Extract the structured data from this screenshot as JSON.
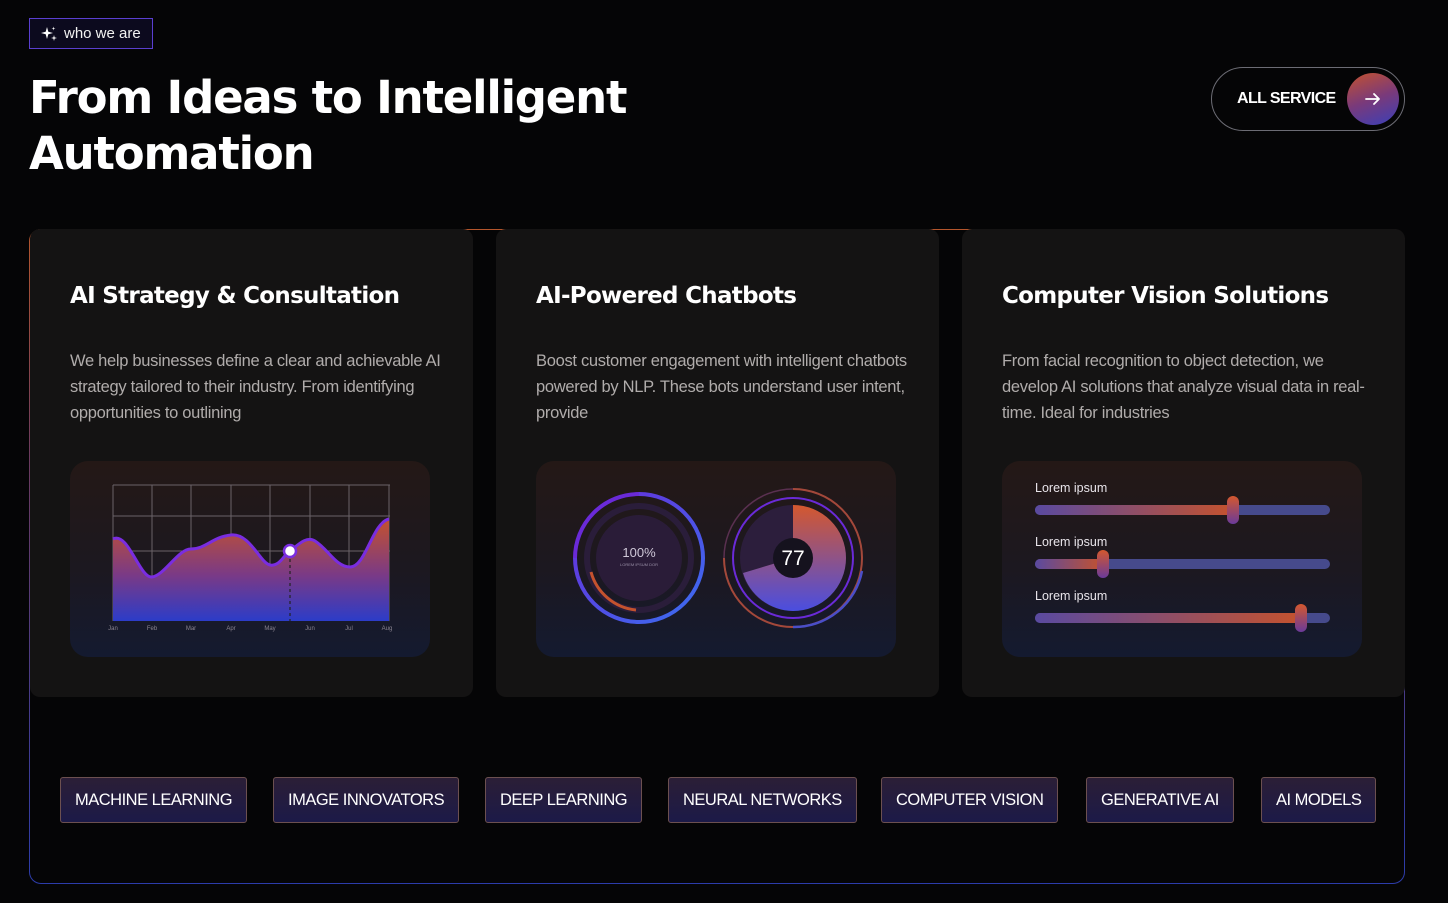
{
  "badge": {
    "label": "who we are",
    "icon": "sparkle-icon"
  },
  "hero": {
    "title": "From Ideas to Intelligent Automation"
  },
  "cta": {
    "label": "ALL SERVICE",
    "icon": "arrow-right-icon"
  },
  "colors": {
    "accent_orange": "#c4522e",
    "accent_blue": "#3a3fb8",
    "accent_purple": "#6a36c8"
  },
  "cards": [
    {
      "title": "AI Strategy & Consultation",
      "description": "We help businesses define a clear and achievable AI strategy tailored to their industry. From identifying opportunities to outlining",
      "chart": {
        "months": [
          "Jan",
          "Feb",
          "Mar",
          "Apr",
          "May",
          "Jun",
          "Jul",
          "Aug"
        ]
      }
    },
    {
      "title": "AI-Powered Chatbots",
      "description": "Boost customer engagement with intelligent chatbots powered by NLP. These bots understand user intent, provide",
      "gauge1": {
        "value": "100%",
        "caption": "LOREM IPSUM DOR"
      },
      "gauge2": {
        "value": "77"
      }
    },
    {
      "title": "Computer Vision Solutions",
      "description": "From facial recognition to object detection, we develop AI solutions that analyze visual data in real-time. Ideal for industries",
      "sliders": [
        {
          "label": "Lorem ipsum",
          "value": 0.67
        },
        {
          "label": "Lorem ipsum",
          "value": 0.23
        },
        {
          "label": "Lorem ipsum",
          "value": 0.9
        }
      ]
    }
  ],
  "tags": [
    "MACHINE LEARNING",
    "IMAGE INNOVATORS",
    "DEEP LEARNING",
    "NEURAL NETWORKS",
    "COMPUTER VISION",
    "GENERATIVE AI",
    "AI MODELS"
  ]
}
